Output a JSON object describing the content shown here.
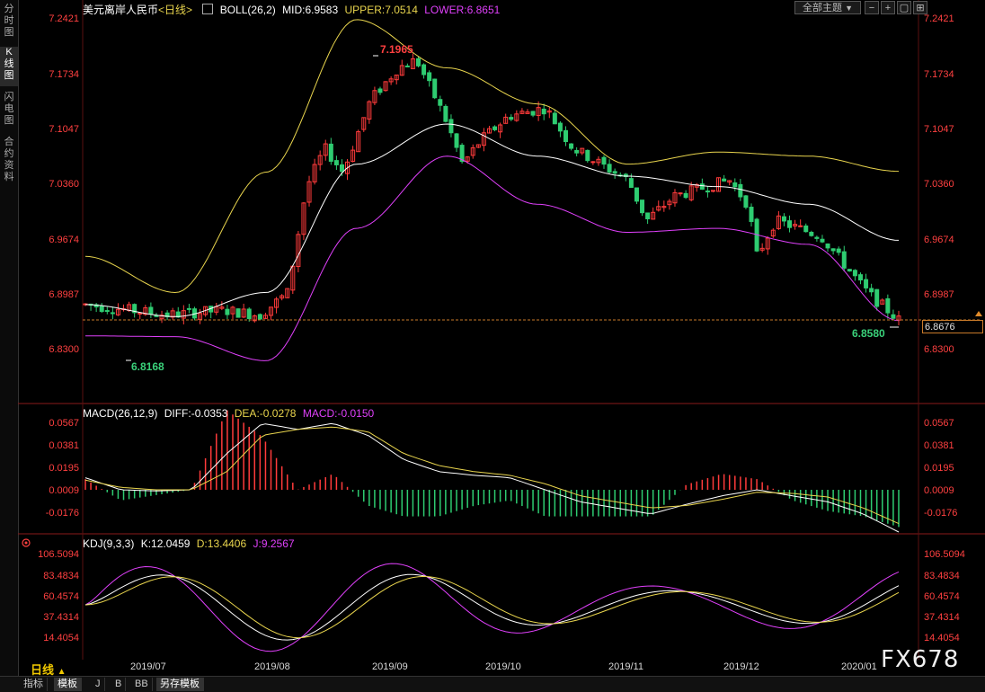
{
  "sidebar": {
    "tabs": [
      {
        "label": "分时图",
        "active": false
      },
      {
        "label": "K线图",
        "active": true
      },
      {
        "label": "闪电图",
        "active": false
      },
      {
        "label": "合约资料",
        "active": false
      }
    ]
  },
  "toolbar": {
    "theme_select": "全部主题",
    "theme_arrow": "▼"
  },
  "main_panel": {
    "instrument": "美元离岸人民币",
    "period_tag": "<日线>",
    "indicator": "BOLL(26,2)",
    "mid": "MID:6.9583",
    "upper": "UPPER:7.0514",
    "lower": "LOWER:6.8651",
    "high_label": "7.1965",
    "low_label": "6.8168",
    "last_low_label": "6.8580",
    "current_price": "6.8676",
    "y_ticks": [
      "7.2421",
      "7.1734",
      "7.1047",
      "7.0360",
      "6.9674",
      "6.8987",
      "6.8300"
    ]
  },
  "macd_panel": {
    "title": "MACD(26,12,9)",
    "diff": "DIFF:-0.0353",
    "dea": "DEA:-0.0278",
    "macd": "MACD:-0.0150",
    "y_ticks": [
      "0.0567",
      "0.0381",
      "0.0195",
      "0.0009",
      "-0.0176"
    ]
  },
  "kdj_panel": {
    "title": "KDJ(9,3,3)",
    "k": "K:12.0459",
    "d": "D:13.4406",
    "j": "J:9.2567",
    "y_ticks": [
      "106.5094",
      "83.4834",
      "60.4574",
      "37.4314",
      "14.4054"
    ]
  },
  "x_axis": {
    "period_label": "日线",
    "period_arrow": "▲",
    "dates": [
      "2019/07",
      "2019/08",
      "2019/09",
      "2019/10",
      "2019/11",
      "2019/12",
      "2020/01"
    ]
  },
  "bottom_tabs": [
    "指标",
    "模板",
    "J",
    "B",
    "BB",
    "另存模板"
  ],
  "watermark": "FX678",
  "colors": {
    "up": "#ff3b3b",
    "down": "#2ecc71",
    "mid_line": "#ffffff",
    "upper_line": "#e8d44d",
    "lower_line": "#e040fb",
    "axis_text": "#ff4040",
    "dashed_price": "#c87a2a"
  },
  "chart_data": [
    {
      "type": "candlestick",
      "title": "美元离岸人民币",
      "overlays": [
        "BOLL MID",
        "BOLL UPPER",
        "BOLL LOWER"
      ],
      "ylim": [
        6.8,
        7.26
      ],
      "x": [
        "2019/07",
        "2019/08",
        "2019/09",
        "2019/10",
        "2019/11",
        "2019/12",
        "2020/01"
      ],
      "series": [
        {
          "name": "MID",
          "values": [
            6.885,
            6.87,
            6.9,
            7.06,
            7.11,
            7.07,
            7.045,
            7.032,
            7.01,
            6.965
          ]
        },
        {
          "name": "UPPER",
          "values": [
            6.945,
            6.9,
            7.05,
            7.24,
            7.18,
            7.135,
            7.06,
            7.075,
            7.07,
            7.051
          ]
        },
        {
          "name": "LOWER",
          "values": [
            6.846,
            6.845,
            6.815,
            6.98,
            7.07,
            7.01,
            6.975,
            6.98,
            6.96,
            6.865
          ]
        }
      ],
      "annotations": {
        "high": 7.1965,
        "low": 6.8168,
        "last_low": 6.858,
        "current": 6.8676
      }
    },
    {
      "type": "macd",
      "title": "MACD(26,12,9)",
      "ylim": [
        -0.03,
        0.06
      ],
      "series": [
        {
          "name": "DIFF",
          "last": -0.0353
        },
        {
          "name": "DEA",
          "last": -0.0278
        },
        {
          "name": "MACD",
          "last": -0.015
        }
      ]
    },
    {
      "type": "kdj",
      "title": "KDJ(9,3,3)",
      "ylim": [
        0,
        110
      ],
      "series": [
        {
          "name": "K",
          "last": 12.0459
        },
        {
          "name": "D",
          "last": 13.4406
        },
        {
          "name": "J",
          "last": 9.2567
        }
      ]
    }
  ]
}
